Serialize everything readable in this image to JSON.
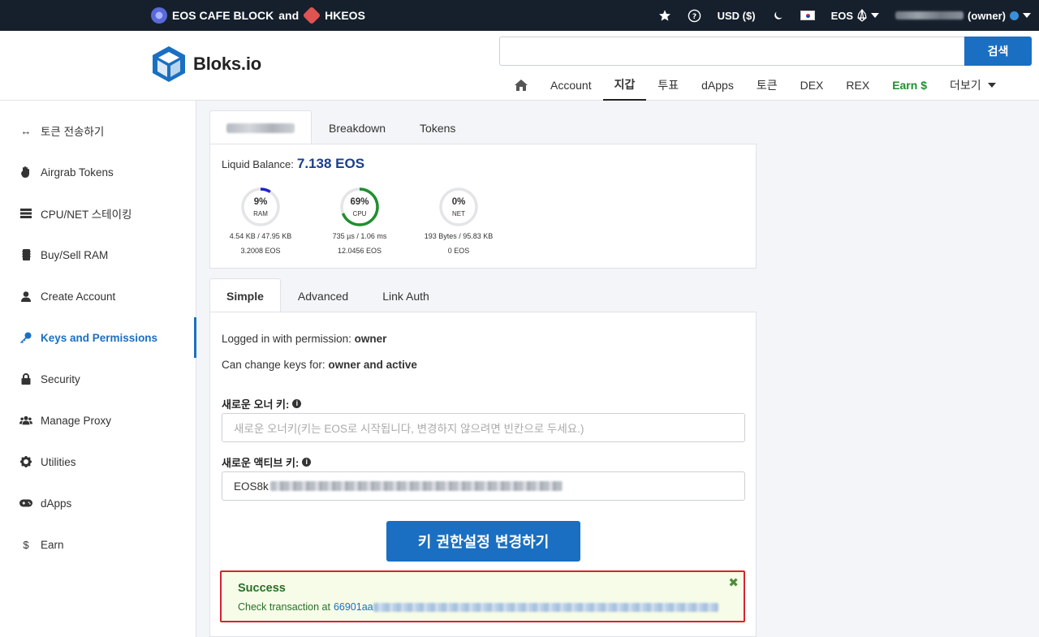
{
  "topbar": {
    "sponsor_a": "EOS CAFE BLOCK",
    "and": "and",
    "sponsor_b": "HKEOS",
    "currency": "USD ($)",
    "chain": "EOS",
    "account_suffix": "(owner)"
  },
  "header": {
    "logo": "Bloks.io",
    "search_placeholder": "",
    "search_button": "검색"
  },
  "nav": {
    "items": [
      "Account",
      "지갑",
      "투표",
      "dApps",
      "토큰",
      "DEX",
      "REX",
      "Earn $",
      "더보기"
    ],
    "active": "지갑"
  },
  "sidebar": {
    "items": [
      {
        "label": "토큰 전송하기",
        "icon": "arrows-left-right-icon"
      },
      {
        "label": "Airgrab Tokens",
        "icon": "hand-icon"
      },
      {
        "label": "CPU/NET 스테이킹",
        "icon": "server-icon"
      },
      {
        "label": "Buy/Sell RAM",
        "icon": "memory-icon"
      },
      {
        "label": "Create Account",
        "icon": "user-icon"
      },
      {
        "label": "Keys and Permissions",
        "icon": "key-icon"
      },
      {
        "label": "Security",
        "icon": "lock-icon"
      },
      {
        "label": "Manage Proxy",
        "icon": "users-icon"
      },
      {
        "label": "Utilities",
        "icon": "gear-icon"
      },
      {
        "label": "dApps",
        "icon": "gamepad-icon"
      },
      {
        "label": "Earn",
        "icon": "dollar-icon"
      }
    ],
    "active": "Keys and Permissions"
  },
  "account_tabs": {
    "tabs": [
      "Breakdown",
      "Tokens"
    ]
  },
  "balance": {
    "label": "Liquid Balance:",
    "value": "7.138 EOS"
  },
  "resources": [
    {
      "name": "RAM",
      "percent": 9,
      "pct_text": "9%",
      "usage": "4.54 KB / 47.95 KB",
      "staked": "3.2008 EOS",
      "color": "#1f22d6"
    },
    {
      "name": "CPU",
      "percent": 69,
      "pct_text": "69%",
      "usage": "735 µs / 1.06 ms",
      "staked": "12.0456 EOS",
      "color": "#1f8f2e"
    },
    {
      "name": "NET",
      "percent": 0,
      "pct_text": "0%",
      "usage": "193 Bytes / 95.83 KB",
      "staked": "0 EOS",
      "color": "#1f8f2e"
    }
  ],
  "perm_tabs": {
    "tabs": [
      "Simple",
      "Advanced",
      "Link Auth"
    ],
    "active": "Simple"
  },
  "form": {
    "logged_in_label": "Logged in with permission:",
    "logged_in_value": "owner",
    "can_change_label": "Can change keys for:",
    "can_change_value": "owner and active",
    "owner_key_label": "새로운 오너 키:",
    "owner_key_placeholder": "새로운 오너키(키는 EOS로 시작됩니다, 변경하지 않으려면 빈칸으로 두세요.)",
    "active_key_label": "새로운 액티브 키:",
    "active_key_value": "EOS8k",
    "submit_label": "키 권한설정 변경하기"
  },
  "alert": {
    "title": "Success",
    "body_label": "Check transaction at",
    "tx_prefix": "66901aa",
    "close": "✖"
  },
  "colors": {
    "topbar": "#16202c",
    "accent": "#1a6fc2",
    "earn": "#1f8f2e",
    "alert_bg": "#f6fce7",
    "alert_border": "#d9232d"
  }
}
